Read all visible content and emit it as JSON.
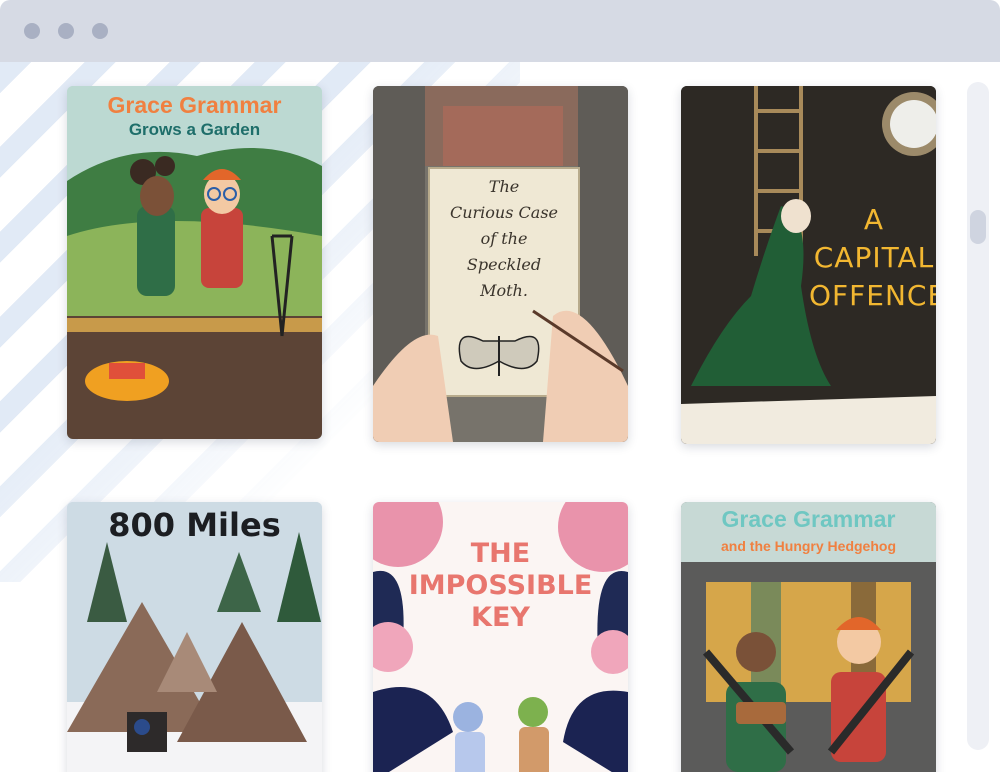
{
  "window": {
    "controls": [
      "close-dot",
      "minimize-dot",
      "maximize-dot"
    ]
  },
  "books": [
    {
      "title_line1": "Grace Grammar",
      "title_line2": "Grows a Garden"
    },
    {
      "title_lines": [
        "The",
        "Curious Case",
        "of the",
        "Speckled",
        "Moth."
      ]
    },
    {
      "title_lines": [
        "A",
        "CAPITAL",
        "OFFENCE"
      ]
    },
    {
      "title": "800 Miles"
    },
    {
      "title_lines": [
        "THE",
        "IMPOSSIBLE",
        "KEY"
      ]
    },
    {
      "title_line1": "Grace Grammar",
      "title_line2": "and the Hungry Hedgehog"
    }
  ],
  "colors": {
    "browser_bar": "#d6dae4",
    "grace_orange": "#f08040",
    "grace_teal": "#1e6e6a",
    "capital_gold": "#f2b731",
    "impossible_pink": "#e8766e"
  }
}
